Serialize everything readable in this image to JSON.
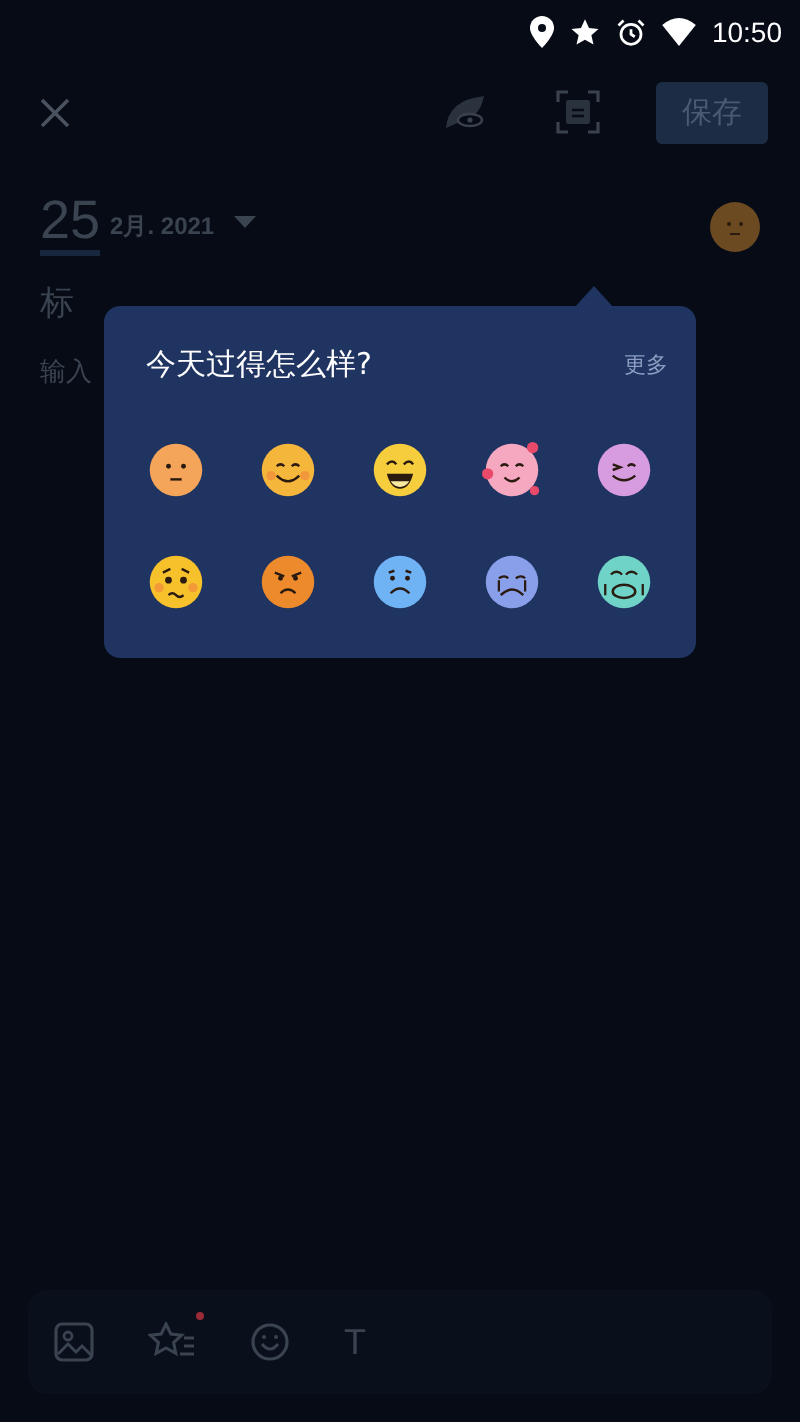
{
  "status_bar": {
    "time": "10:50"
  },
  "header": {
    "save_button": "保存"
  },
  "date": {
    "day": "25",
    "month_year": "2月. 2021"
  },
  "editor": {
    "title_placeholder": "标",
    "body_placeholder": "输入"
  },
  "mood_picker": {
    "title": "今天过得怎么样?",
    "more": "更多",
    "moods": [
      {
        "kind": "neutral",
        "color": "#f4a55a"
      },
      {
        "kind": "smile",
        "color": "#f5b63c"
      },
      {
        "kind": "laugh",
        "color": "#f6cd3c"
      },
      {
        "kind": "love",
        "color": "#f6a8c0"
      },
      {
        "kind": "wink",
        "color": "#d79be0"
      },
      {
        "kind": "worried",
        "color": "#f7c12c"
      },
      {
        "kind": "angry",
        "color": "#ec8a2c"
      },
      {
        "kind": "sad",
        "color": "#6fb3f5"
      },
      {
        "kind": "cry",
        "color": "#8a9fea"
      },
      {
        "kind": "sob",
        "color": "#6fd3c8"
      }
    ]
  },
  "toolbar": {
    "text_tool": "T",
    "star_badge": true
  }
}
